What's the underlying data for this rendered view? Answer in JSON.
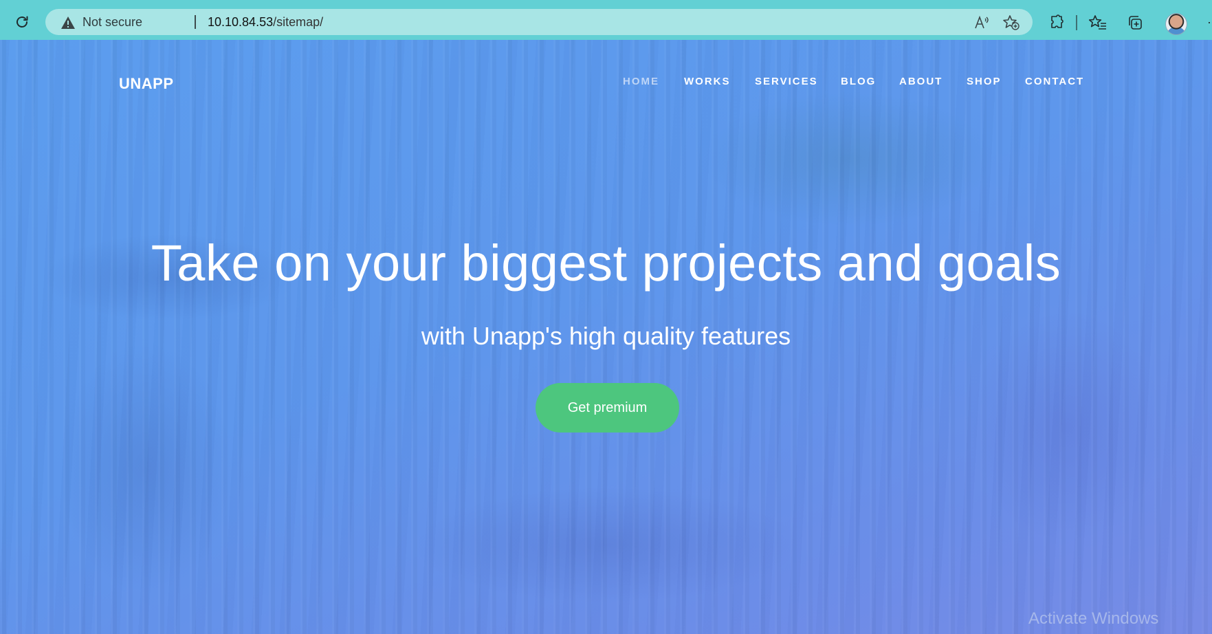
{
  "browser": {
    "security_label": "Not secure",
    "url_host": "10.10.84.53",
    "url_path": "/sitemap/",
    "icons": [
      "reload-icon",
      "warning-icon",
      "read-aloud-icon",
      "add-favorite-icon",
      "extensions-icon",
      "favorites-icon",
      "collections-icon",
      "profile-avatar",
      "more-icon"
    ]
  },
  "site": {
    "logo": "UNAPP",
    "nav": [
      {
        "label": "HOME",
        "active": true
      },
      {
        "label": "WORKS",
        "active": false
      },
      {
        "label": "SERVICES",
        "active": false
      },
      {
        "label": "BLOG",
        "active": false
      },
      {
        "label": "ABOUT",
        "active": false
      },
      {
        "label": "SHOP",
        "active": false
      },
      {
        "label": "CONTACT",
        "active": false
      }
    ]
  },
  "hero": {
    "headline": "Take on your biggest projects and goals",
    "subheadline": "with Unapp's high quality features",
    "cta_label": "Get premium"
  },
  "os": {
    "watermark": "Activate Windows"
  },
  "colors": {
    "browser_bar": "#62d0d4",
    "address_bar": "#a8e5e5",
    "hero_overlay": "#5e97ec",
    "cta": "#4dc67e"
  }
}
